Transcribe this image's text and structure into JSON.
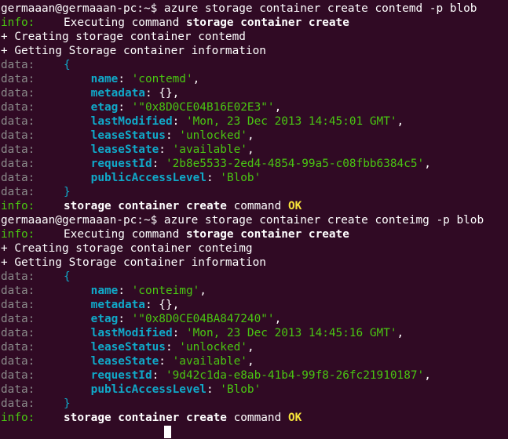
{
  "colors": {
    "background": "#300a24",
    "info": "#4ac612",
    "data": "#8a8a8a",
    "key": "#10a9c9",
    "string": "#4ac612",
    "ok": "#f7e33a"
  },
  "labels": {
    "info": "info:",
    "data": "data:"
  },
  "blocks": [
    {
      "prompt": "germaaan@germaaan-pc:~$ azure storage container create contemd -p blob",
      "exec_prefix": "Executing command ",
      "exec_cmd": "storage container create",
      "creating": "+ Creating storage container contemd",
      "getting": "+ Getting Storage container information",
      "open": "{",
      "close": "}",
      "fields": [
        {
          "key": "name",
          "value": "'contemd'"
        },
        {
          "key": "metadata",
          "value": "{}"
        },
        {
          "key": "etag",
          "value": "'\"0x8D0CE04B16E02E3\"'"
        },
        {
          "key": "lastModified",
          "value": "'Mon, 23 Dec 2013 14:45:01 GMT'"
        },
        {
          "key": "leaseStatus",
          "value": "'unlocked'"
        },
        {
          "key": "leaseState",
          "value": "'available'"
        },
        {
          "key": "requestId",
          "value": "'2b8e5533-2ed4-4854-99a5-c08fbb6384c5'"
        },
        {
          "key": "publicAccessLevel",
          "value": "'Blob'"
        }
      ],
      "result_cmd": "storage container create",
      "result_word": "command",
      "result_ok": "OK"
    },
    {
      "prompt": "germaaan@germaaan-pc:~$ azure storage container create conteimg -p blob",
      "exec_prefix": "Executing command ",
      "exec_cmd": "storage container create",
      "creating": "+ Creating storage container conteimg",
      "getting": "+ Getting Storage container information",
      "open": "{",
      "close": "}",
      "fields": [
        {
          "key": "name",
          "value": "'conteimg'"
        },
        {
          "key": "metadata",
          "value": "{}"
        },
        {
          "key": "etag",
          "value": "'\"0x8D0CE04BA847240\"'"
        },
        {
          "key": "lastModified",
          "value": "'Mon, 23 Dec 2013 14:45:16 GMT'"
        },
        {
          "key": "leaseStatus",
          "value": "'unlocked'"
        },
        {
          "key": "leaseState",
          "value": "'available'"
        },
        {
          "key": "requestId",
          "value": "'9d42c1da-e8ab-41b4-99f8-26fc21910187'"
        },
        {
          "key": "publicAccessLevel",
          "value": "'Blob'"
        }
      ],
      "result_cmd": "storage container create",
      "result_word": "command",
      "result_ok": "OK"
    }
  ]
}
